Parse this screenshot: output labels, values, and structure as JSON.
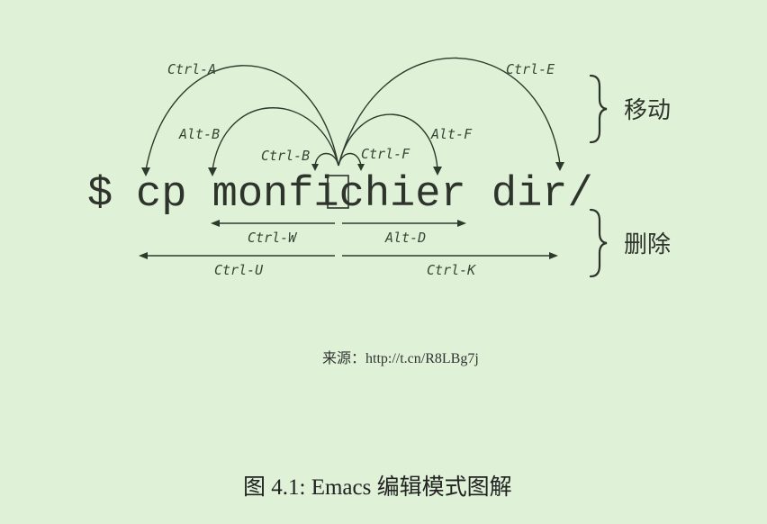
{
  "command": {
    "prompt": "$",
    "text": "cp monfichier dir/"
  },
  "move": {
    "label": "移动",
    "keys": {
      "ctrl_a": "Ctrl-A",
      "ctrl_e": "Ctrl-E",
      "alt_b": "Alt-B",
      "alt_f": "Alt-F",
      "ctrl_b": "Ctrl-B",
      "ctrl_f": "Ctrl-F"
    }
  },
  "delete": {
    "label": "删除",
    "keys": {
      "ctrl_w": "Ctrl-W",
      "alt_d": "Alt-D",
      "ctrl_u": "Ctrl-U",
      "ctrl_k": "Ctrl-K"
    }
  },
  "source": "来源：http://t.cn/R8LBg7j",
  "caption": "图 4.1: Emacs 编辑模式图解"
}
